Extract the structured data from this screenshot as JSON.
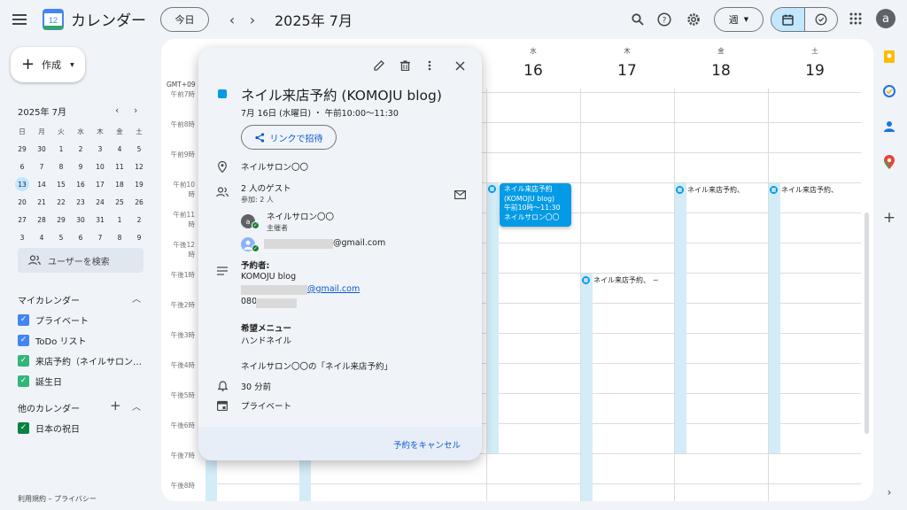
{
  "header": {
    "app_title": "カレンダー",
    "logo_day": "12",
    "today_label": "今日",
    "current_period": "2025年 7月",
    "view_label": "週",
    "avatar_letter": "a"
  },
  "sidebar": {
    "create_label": "作成",
    "mini_cal": {
      "title": "2025年 7月",
      "dow": [
        "日",
        "月",
        "火",
        "水",
        "木",
        "金",
        "土"
      ],
      "weeks": [
        [
          "29",
          "30",
          "1",
          "2",
          "3",
          "4",
          "5"
        ],
        [
          "6",
          "7",
          "8",
          "9",
          "10",
          "11",
          "12"
        ],
        [
          "13",
          "14",
          "15",
          "16",
          "17",
          "18",
          "19"
        ],
        [
          "20",
          "21",
          "22",
          "23",
          "24",
          "25",
          "26"
        ],
        [
          "27",
          "28",
          "29",
          "30",
          "31",
          "1",
          "2"
        ],
        [
          "3",
          "4",
          "5",
          "6",
          "7",
          "8",
          "9"
        ]
      ],
      "today": "13"
    },
    "user_search": "ユーザーを検索",
    "my_calendars_title": "マイカレンダー",
    "my_calendars": [
      {
        "label": "プライベート",
        "color": "#4285f4"
      },
      {
        "label": "ToDo リスト",
        "color": "#4285f4"
      },
      {
        "label": "来店予約（ネイルサロン…",
        "color": "#33b679"
      },
      {
        "label": "誕生日",
        "color": "#33b679"
      }
    ],
    "other_calendars_title": "他のカレンダー",
    "other_calendars": [
      {
        "label": "日本の祝日",
        "color": "#0b8043"
      }
    ],
    "footer": "利用規約 – プライバシー"
  },
  "calendar": {
    "timezone": "GMT+09",
    "days": [
      {
        "dow": "水",
        "date": "16"
      },
      {
        "dow": "木",
        "date": "17"
      },
      {
        "dow": "金",
        "date": "18"
      },
      {
        "dow": "土",
        "date": "19"
      }
    ],
    "hours": [
      "午前7時",
      "午前8時",
      "午前9時",
      "午前10時",
      "午前11時",
      "午後12時",
      "午後1時",
      "午後2時",
      "午後3時",
      "午後4時",
      "午後5時",
      "午後6時",
      "午後7時",
      "午後8時"
    ],
    "events": {
      "selected": {
        "title": "ネイル来店予約",
        "subtitle": "(KOMOJU blog)",
        "time": "午前10時～11:30",
        "location": "ネイルサロン〇〇"
      },
      "chip_thu": "ネイル来店予約、",
      "chip_fri": "ネイル来店予約、",
      "chip_sat": "ネイル来店予約、"
    }
  },
  "popup": {
    "title": "ネイル来店予約 (KOMOJU blog)",
    "when": "7月 16日 (水曜日) ・ 午前10:00～11:30",
    "invite_link": "リンクで招待",
    "location": "ネイルサロン〇〇",
    "guests_count": "2 人のゲスト",
    "guests_sub": "参加: 2 人",
    "guest1_name": "ネイルサロン〇〇",
    "guest1_role": "主催者",
    "guest1_initial": "a",
    "guest2_email_suffix": "@gmail.com",
    "desc_booker_label": "予約者:",
    "desc_booker_name": "KOMOJU blog",
    "desc_email_suffix": "@gmail.com",
    "desc_phone_prefix": "080",
    "desc_menu_label": "希望メニュー",
    "desc_menu_value": "ハンドネイル",
    "desc_source": "ネイルサロン〇〇の「ネイル来店予約」",
    "reminder": "30 分前",
    "calendar_name": "プライベート",
    "cancel_label": "予約をキャンセル"
  }
}
